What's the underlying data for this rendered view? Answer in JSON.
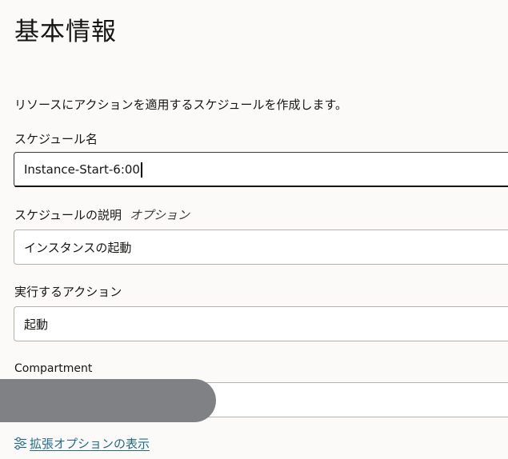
{
  "section": {
    "title": "基本情報",
    "description": "リソースにアクションを適用するスケジュールを作成します。"
  },
  "fields": {
    "schedule_name": {
      "label": "スケジュール名",
      "value": "Instance-Start-6:00"
    },
    "schedule_description": {
      "label": "スケジュールの説明",
      "optional_tag": "オプション",
      "value": "インスタンスの起動"
    },
    "action": {
      "label": "実行するアクション",
      "value": "起動"
    },
    "compartment": {
      "label": "Compartment",
      "value": ""
    }
  },
  "advanced": {
    "link_label": "拡張オプションの表示",
    "icon": "sliders-icon"
  },
  "colors": {
    "background": "#fbfaf8",
    "link": "#1f6a8a",
    "redaction": "#808184",
    "input_border": "#b7b3ab"
  }
}
